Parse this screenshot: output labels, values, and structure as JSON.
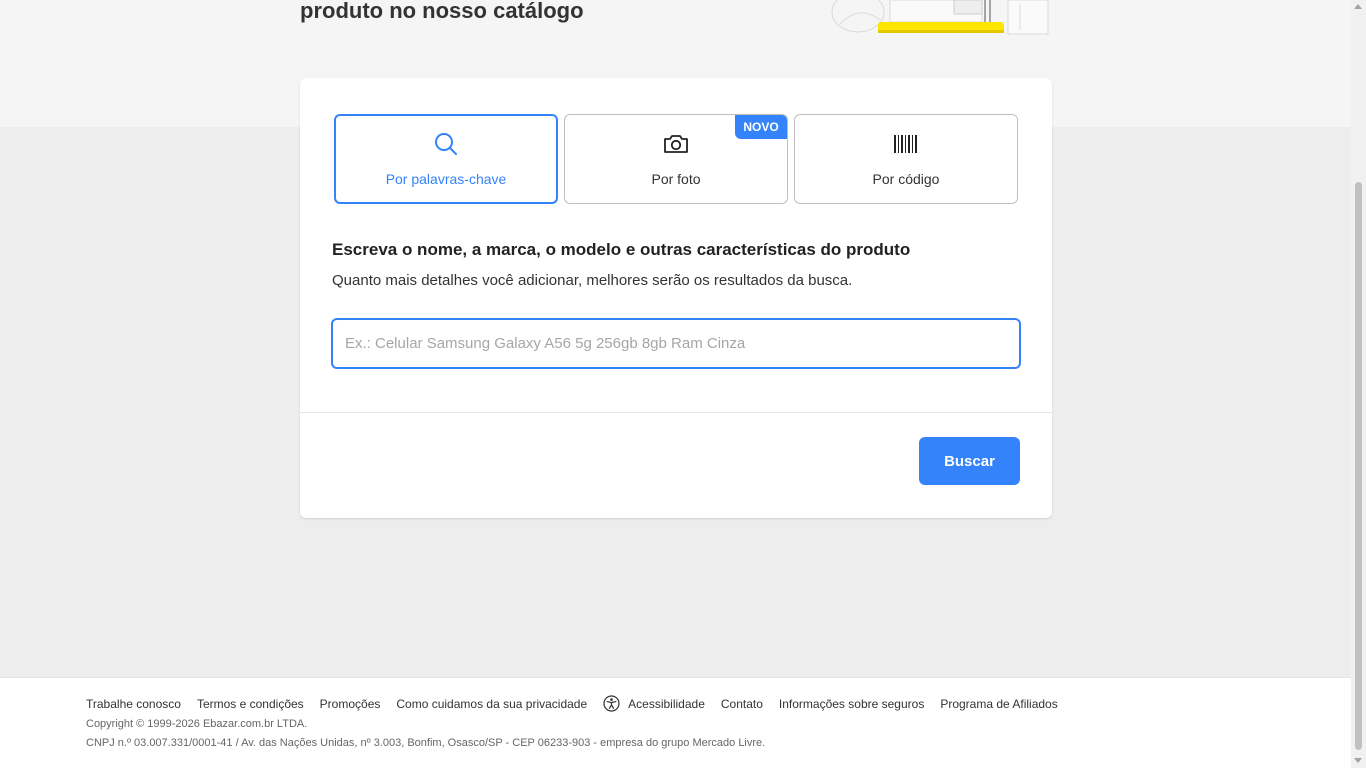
{
  "hero": {
    "title": "produto no nosso catálogo"
  },
  "options": [
    {
      "label": "Por palavras-chave",
      "icon": "search-icon",
      "selected": true
    },
    {
      "label": "Por foto",
      "icon": "camera-icon",
      "badge": "NOVO",
      "selected": false
    },
    {
      "label": "Por código",
      "icon": "barcode-icon",
      "selected": false
    }
  ],
  "form": {
    "heading": "Escreva o nome, a marca, o modelo e outras características do produto",
    "subheading": "Quanto mais detalhes você adicionar, melhores serão os resultados da busca.",
    "search_placeholder": "Ex.: Celular Samsung Galaxy A56 5g 256gb 8gb Ram Cinza",
    "search_value": "",
    "submit_label": "Buscar"
  },
  "footer": {
    "links": [
      "Trabalhe conosco",
      "Termos e condições",
      "Promoções",
      "Como cuidamos da sua privacidade",
      "Acessibilidade",
      "Contato",
      "Informações sobre seguros",
      "Programa de Afiliados"
    ],
    "copyright": "Copyright © 1999-2026 Ebazar.com.br LTDA.",
    "address": "CNPJ n.º 03.007.331/0001-41 / Av. das Nações Unidas, nº 3.003, Bonfim, Osasco/SP - CEP 06233-903 - empresa do grupo Mercado Livre."
  },
  "colors": {
    "accent": "#3483fa",
    "page_bg": "#ededed",
    "top_band": "#f5f5f5",
    "illustration_yellow": "#ffe600"
  }
}
